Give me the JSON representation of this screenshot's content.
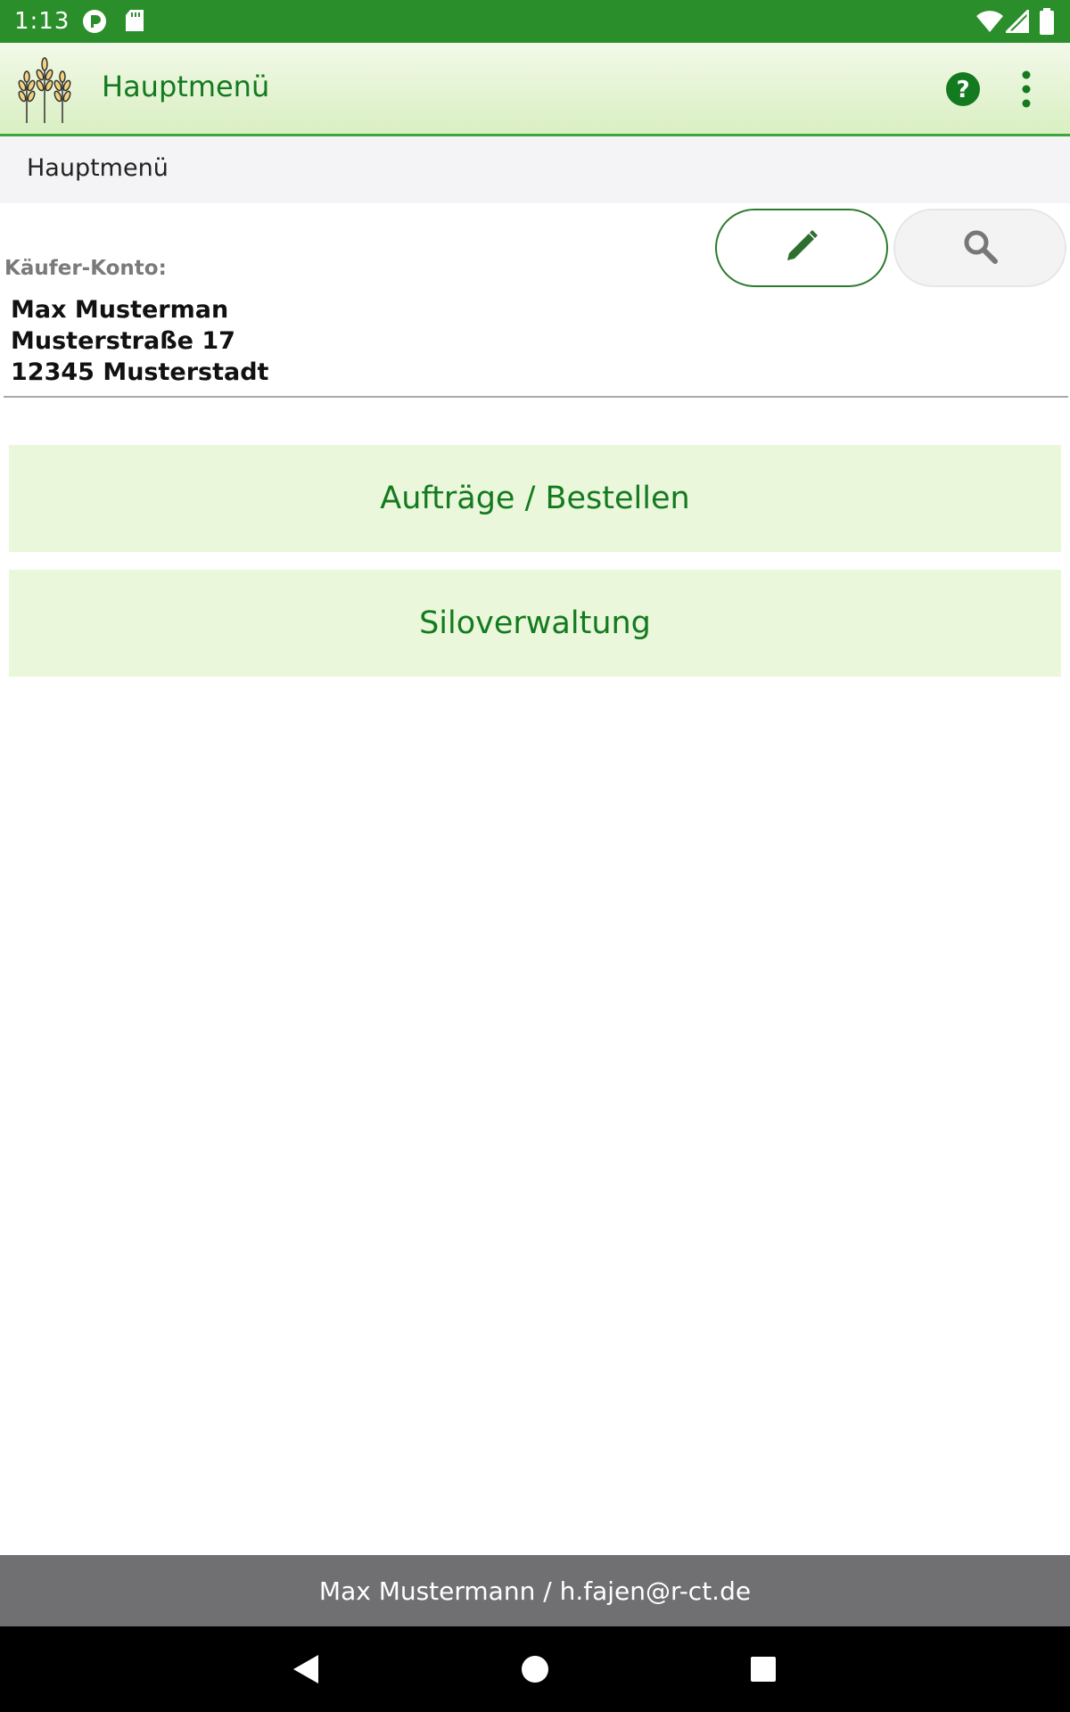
{
  "status_bar": {
    "time": "1:13",
    "icons": [
      "notification-icon",
      "sd-card-icon",
      "wifi-icon",
      "cell-signal-icon",
      "battery-icon"
    ]
  },
  "app_bar": {
    "title": "Hauptmenü",
    "logo_icon": "wheat-icon",
    "help_icon": "help-icon",
    "menu_icon": "more-vert-icon"
  },
  "breadcrumb": {
    "label": "Hauptmenü"
  },
  "account": {
    "label": "Käufer-Konto:",
    "name": "Max Musterman",
    "street": "Musterstraße 17",
    "city": "12345 Musterstadt",
    "edit_icon": "pencil-icon",
    "search_icon": "search-icon"
  },
  "menu": {
    "items": [
      {
        "label": "Aufträge / Bestellen"
      },
      {
        "label": "Siloverwaltung"
      }
    ]
  },
  "footer": {
    "text": "Max Mustermann / h.fajen@r-ct.de"
  },
  "colors": {
    "status_bar": "#2a8f2a",
    "accent_green": "#137a1f",
    "menu_button_bg": "#eaf7da",
    "footer_bg": "#707073"
  }
}
